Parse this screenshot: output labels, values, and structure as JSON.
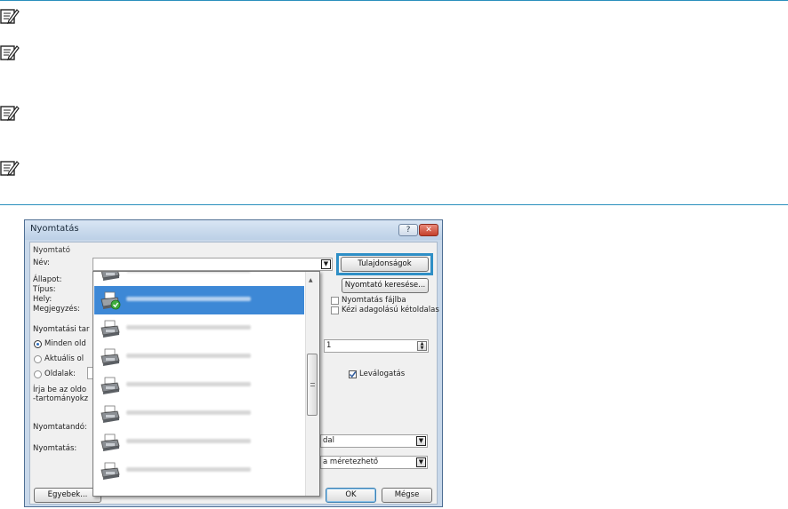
{
  "dialog": {
    "title": "Nyomtatás",
    "help_label": "?",
    "close_label": "✕",
    "printer_group_label": "Nyomtató",
    "name_label": "Név:",
    "status_label": "Állapot:",
    "type_label": "Típus:",
    "location_label": "Hely:",
    "comment_label": "Megjegyzés:",
    "properties_button": "Tulajdonságok",
    "find_printer_button": "Nyomtató keresése...",
    "print_to_file_label": "Nyomtatás fájlba",
    "manual_duplex_label": "Kézi adagolású kétoldalas",
    "range_group_label": "Nyomtatási tar",
    "all_pages_label": "Minden old",
    "current_page_label": "Aktuális ol",
    "pages_label": "Oldalak:",
    "range_hint_1": "Írja be az oldo",
    "range_hint_2": "-tartományokz",
    "copies_value": "1",
    "collate_label": "Leválogatás",
    "print_what_label": "Nyomtatandó:",
    "print_label": "Nyomtatás:",
    "pages_per_sheet_value": "dal",
    "scale_value": "a méretezhető",
    "options_button": "Egyebek...",
    "ok_button": "OK",
    "cancel_button": "Mégse"
  },
  "colors": {
    "accent_rule": "#2a8fbd",
    "selection": "#3d88d6",
    "highlight_box": "#2f8fc6"
  },
  "icons": [
    "note-icon",
    "printer-icon",
    "printer-default-icon"
  ],
  "selected_printer_row": 1
}
